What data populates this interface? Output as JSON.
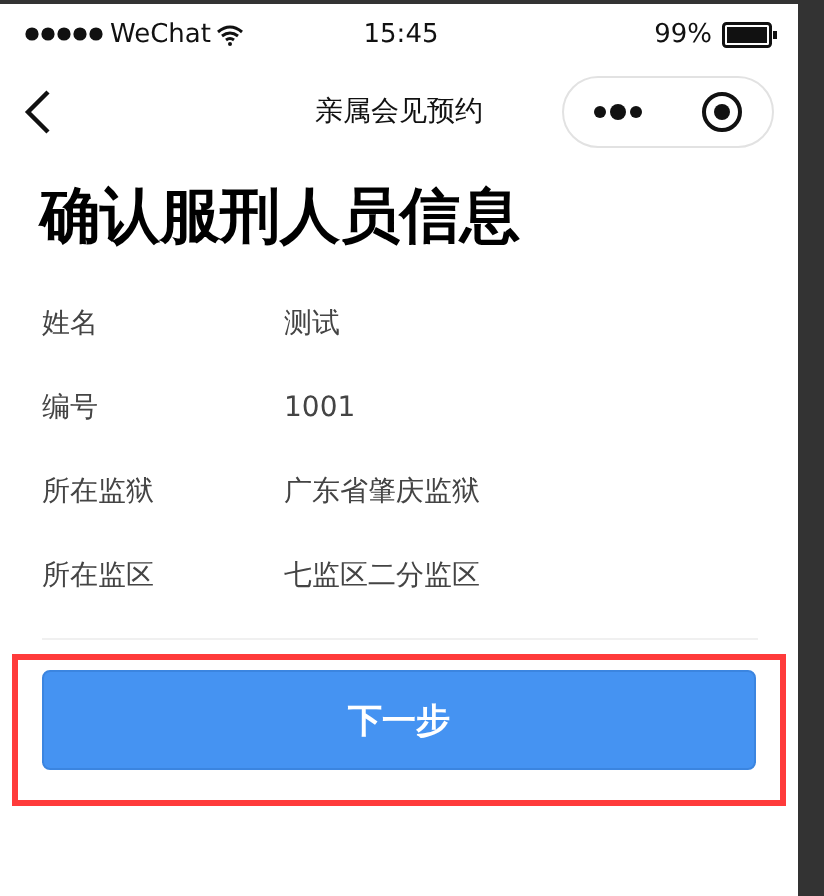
{
  "status_bar": {
    "carrier": "WeChat",
    "time": "15:45",
    "battery": "99%"
  },
  "nav_bar": {
    "title": "亲属会见预约"
  },
  "heading": "确认服刑人员信息",
  "fields": [
    {
      "label": "姓名",
      "value": "测试"
    },
    {
      "label": "编号",
      "value": "1001"
    },
    {
      "label": "所在监狱",
      "value": "广东省肇庆监狱"
    },
    {
      "label": "所在监区",
      "value": "七监区二分监区"
    }
  ],
  "next_button": {
    "label": "下一步",
    "highlighted": true
  }
}
